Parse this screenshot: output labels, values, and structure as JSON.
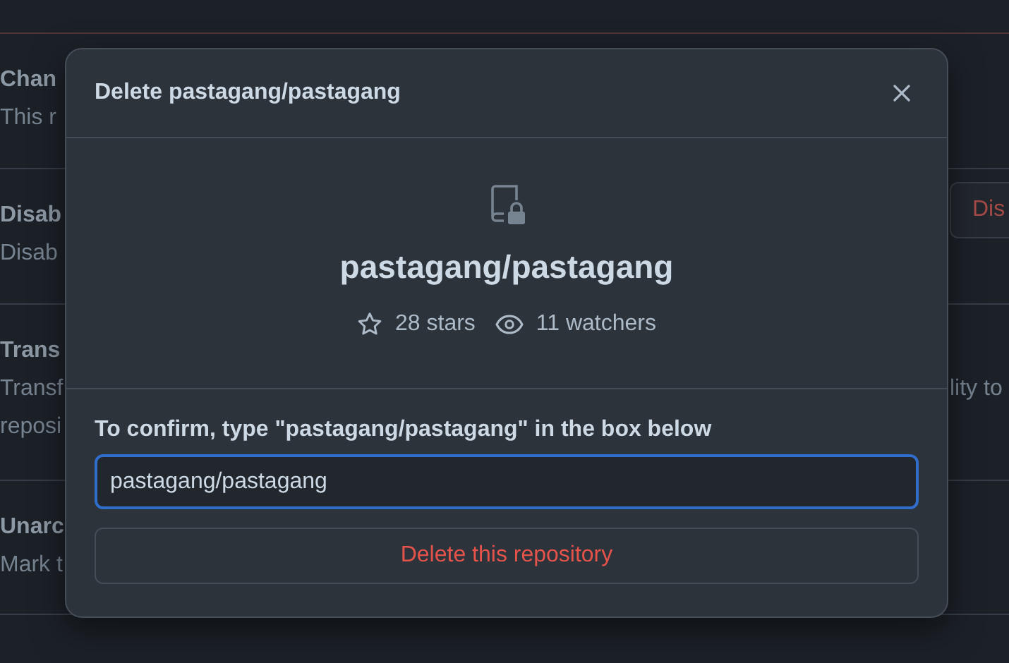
{
  "background": {
    "rows": [
      {
        "title": "Chan",
        "lines": [
          {
            "left": "This r"
          }
        ]
      },
      {
        "title": "Disab",
        "lines": [
          {
            "left": "Disab"
          }
        ],
        "button": "Dis"
      },
      {
        "title": "Trans",
        "lines": [
          {
            "left": "Transf",
            "right": "lity to"
          },
          {
            "left": "reposi"
          }
        ]
      },
      {
        "title": "Unarc",
        "lines": [
          {
            "left": "Mark t"
          }
        ]
      }
    ]
  },
  "dialog": {
    "title": "Delete pastagang/pastagang",
    "repo": "pastagang/pastagang",
    "stars": "28 stars",
    "watchers": "11 watchers",
    "confirm_label": "To confirm, type \"pastagang/pastagang\" in the box below",
    "input_value": "pastagang/pastagang",
    "delete_button": "Delete this repository"
  }
}
